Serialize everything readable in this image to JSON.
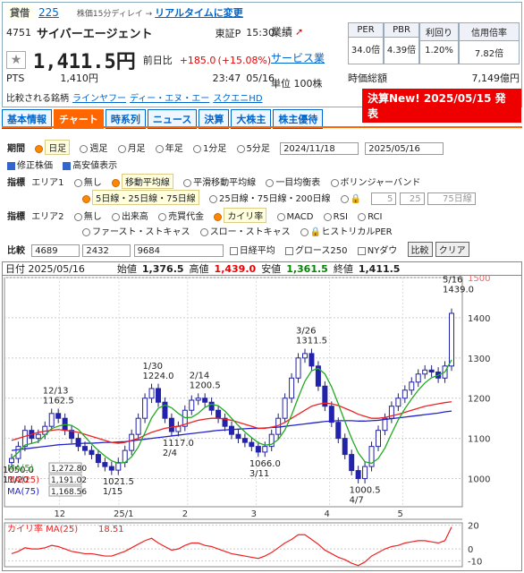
{
  "header": {
    "loan_tag": "貸借",
    "loan_count": "225",
    "delay_note": "株価15分ディレイ →",
    "realtime_link": "リアルタイムに変更",
    "code": "4751",
    "name": "サイバーエージェント",
    "market": "東証P",
    "time": "15:30",
    "price": "1,411.5円",
    "change_label": "前日比",
    "change": "+185.0",
    "change_pct": "(+15.08%)",
    "pts_label": "PTS",
    "pts_price": "1,410円",
    "pts_time": "23:47",
    "pts_date": "05/16",
    "perf_label": "業績",
    "sector_link": "サービス業",
    "unit": "単位 100株",
    "compare_label": "比較される銘柄",
    "compare_links": [
      "ラインヤフー",
      "ディー・エヌ・エー",
      "スクエニHD"
    ],
    "mcap_label": "時価総額",
    "mcap": "7,149億円",
    "news": "決算New! 2025/05/15 発表"
  },
  "kpis": [
    {
      "title": "PER",
      "value": "34.0倍"
    },
    {
      "title": "PBR",
      "value": "4.39倍"
    },
    {
      "title": "利回り",
      "value": "1.20%"
    },
    {
      "title": "信用倍率",
      "value": "7.82倍"
    }
  ],
  "tabs": [
    "基本情報",
    "チャート",
    "時系列",
    "ニュース",
    "決算",
    "大株主",
    "株主優待"
  ],
  "controls": {
    "period_label": "期間",
    "periods": [
      "日足",
      "週足",
      "月足",
      "年足",
      "1分足",
      "5分足"
    ],
    "date_from": "2024/11/18",
    "date_to": "2025/05/16",
    "opt_adjust": "修正株価",
    "opt_hl": "高安値表示",
    "ind_label": "指標",
    "area1": "エリア1",
    "area1_items": [
      "無し",
      "移動平均線",
      "平滑移動平均線",
      "一目均衡表",
      "ボリンジャーバンド"
    ],
    "ma_sets": [
      "5日線・25日線・75日線",
      "25日線・75日線・200日線"
    ],
    "ma_custom": [
      "5",
      "25",
      "75日線"
    ],
    "area2": "エリア2",
    "area2_items": [
      "無し",
      "出来高",
      "売買代金",
      "カイリ率",
      "MACD",
      "RSI",
      "RCI"
    ],
    "area2_items2": [
      "ファースト・ストキャス",
      "スロー・ストキャス",
      "ヒストリカルPER"
    ],
    "compare_label": "比較",
    "compare_codes": [
      "4689",
      "2432",
      "9684"
    ],
    "compare_opts": [
      "日経平均",
      "グロース250",
      "NYダウ"
    ],
    "btn_compare": "比較",
    "btn_clear": "クリア"
  },
  "ohlc_bar": {
    "date": "日付 2025/05/16",
    "open_label": "始値",
    "open": "1,376.5",
    "high_label": "高値",
    "high": "1,439.0",
    "low_label": "安値",
    "low": "1,361.5",
    "close_label": "終値",
    "close": "1,411.5"
  },
  "chart_data": {
    "type": "line",
    "y_ticks": [
      "1500",
      "1400",
      "1300",
      "1200",
      "1100",
      "1000"
    ],
    "ylim": [
      930,
      1500
    ],
    "x_ticks": [
      "12",
      "25/1",
      "2",
      "3",
      "4",
      "5"
    ],
    "annotations": [
      {
        "date": "11/20",
        "value": "1050.0"
      },
      {
        "date": "12/13",
        "value": "1162.5"
      },
      {
        "date": "1/15",
        "value": "1021.5"
      },
      {
        "date": "1/30",
        "value": "1224.0"
      },
      {
        "date": "2/4",
        "value": "1117.0"
      },
      {
        "date": "2/14",
        "value": "1200.5"
      },
      {
        "date": "3/11",
        "value": "1066.0"
      },
      {
        "date": "3/26",
        "value": "1311.5"
      },
      {
        "date": "4/7",
        "value": "1000.5"
      },
      {
        "date": "5/16",
        "value": "1439.0"
      }
    ],
    "legend": [
      {
        "name": "MA(5)",
        "value": "1,272.80",
        "color": "#2a2"
      },
      {
        "name": "MA(25)",
        "value": "1,191.02",
        "color": "#e22"
      },
      {
        "name": "MA(75)",
        "value": "1,168.56",
        "color": "#22c"
      }
    ],
    "closes": [
      1050,
      1080,
      1120,
      1100,
      1110,
      1130,
      1162,
      1150,
      1120,
      1100,
      1080,
      1070,
      1060,
      1040,
      1030,
      1021,
      1040,
      1070,
      1110,
      1150,
      1200,
      1224,
      1190,
      1150,
      1117,
      1130,
      1170,
      1195,
      1200,
      1190,
      1170,
      1150,
      1130,
      1110,
      1100,
      1090,
      1080,
      1066,
      1080,
      1110,
      1150,
      1200,
      1250,
      1300,
      1311,
      1280,
      1230,
      1180,
      1140,
      1100,
      1060,
      1020,
      1000,
      1030,
      1080,
      1120,
      1150,
      1180,
      1200,
      1220,
      1240,
      1260,
      1270,
      1265,
      1250,
      1280,
      1411
    ],
    "ma25": [
      1095,
      1100,
      1105,
      1110,
      1115,
      1118,
      1120,
      1122,
      1120,
      1118,
      1115,
      1110,
      1105,
      1100,
      1095,
      1090,
      1088,
      1090,
      1095,
      1100,
      1108,
      1115,
      1120,
      1125,
      1128,
      1130,
      1135,
      1140,
      1145,
      1148,
      1150,
      1150,
      1148,
      1145,
      1140,
      1135,
      1130,
      1125,
      1125,
      1128,
      1132,
      1140,
      1150,
      1160,
      1170,
      1180,
      1185,
      1188,
      1186,
      1182,
      1175,
      1168,
      1160,
      1155,
      1150,
      1150,
      1152,
      1156,
      1160,
      1165,
      1170,
      1175,
      1180,
      1183,
      1186,
      1189,
      1191
    ],
    "ma75": [
      1070,
      1072,
      1074,
      1076,
      1078,
      1080,
      1082,
      1084,
      1085,
      1086,
      1087,
      1088,
      1088,
      1089,
      1090,
      1090,
      1091,
      1092,
      1094,
      1096,
      1098,
      1100,
      1102,
      1104,
      1106,
      1108,
      1110,
      1112,
      1114,
      1116,
      1118,
      1120,
      1121,
      1122,
      1123,
      1124,
      1125,
      1125,
      1126,
      1127,
      1128,
      1130,
      1132,
      1134,
      1136,
      1138,
      1140,
      1142,
      1143,
      1144,
      1144,
      1144,
      1143,
      1143,
      1144,
      1145,
      1147,
      1149,
      1151,
      1153,
      1155,
      1157,
      1159,
      1161,
      1163,
      1166,
      1168
    ],
    "kairi_label": "カイリ率 MA(25)",
    "kairi_value": "18.51",
    "kairi_ticks": [
      "20",
      "0",
      "-10"
    ],
    "kairi": [
      -4,
      -2,
      1,
      0,
      0,
      1,
      3,
      2,
      0,
      -2,
      -3,
      -4,
      -4,
      -5,
      -6,
      -6,
      -4,
      -2,
      1,
      4,
      7,
      9,
      5,
      2,
      -1,
      0,
      3,
      5,
      5,
      3,
      2,
      0,
      -2,
      -4,
      -5,
      -6,
      -7,
      -8,
      -6,
      -3,
      1,
      5,
      8,
      12,
      12,
      8,
      4,
      -1,
      -4,
      -7,
      -9,
      -12,
      -14,
      -11,
      -6,
      -3,
      0,
      2,
      3,
      5,
      6,
      7,
      7,
      6,
      5,
      7,
      18.51
    ]
  }
}
